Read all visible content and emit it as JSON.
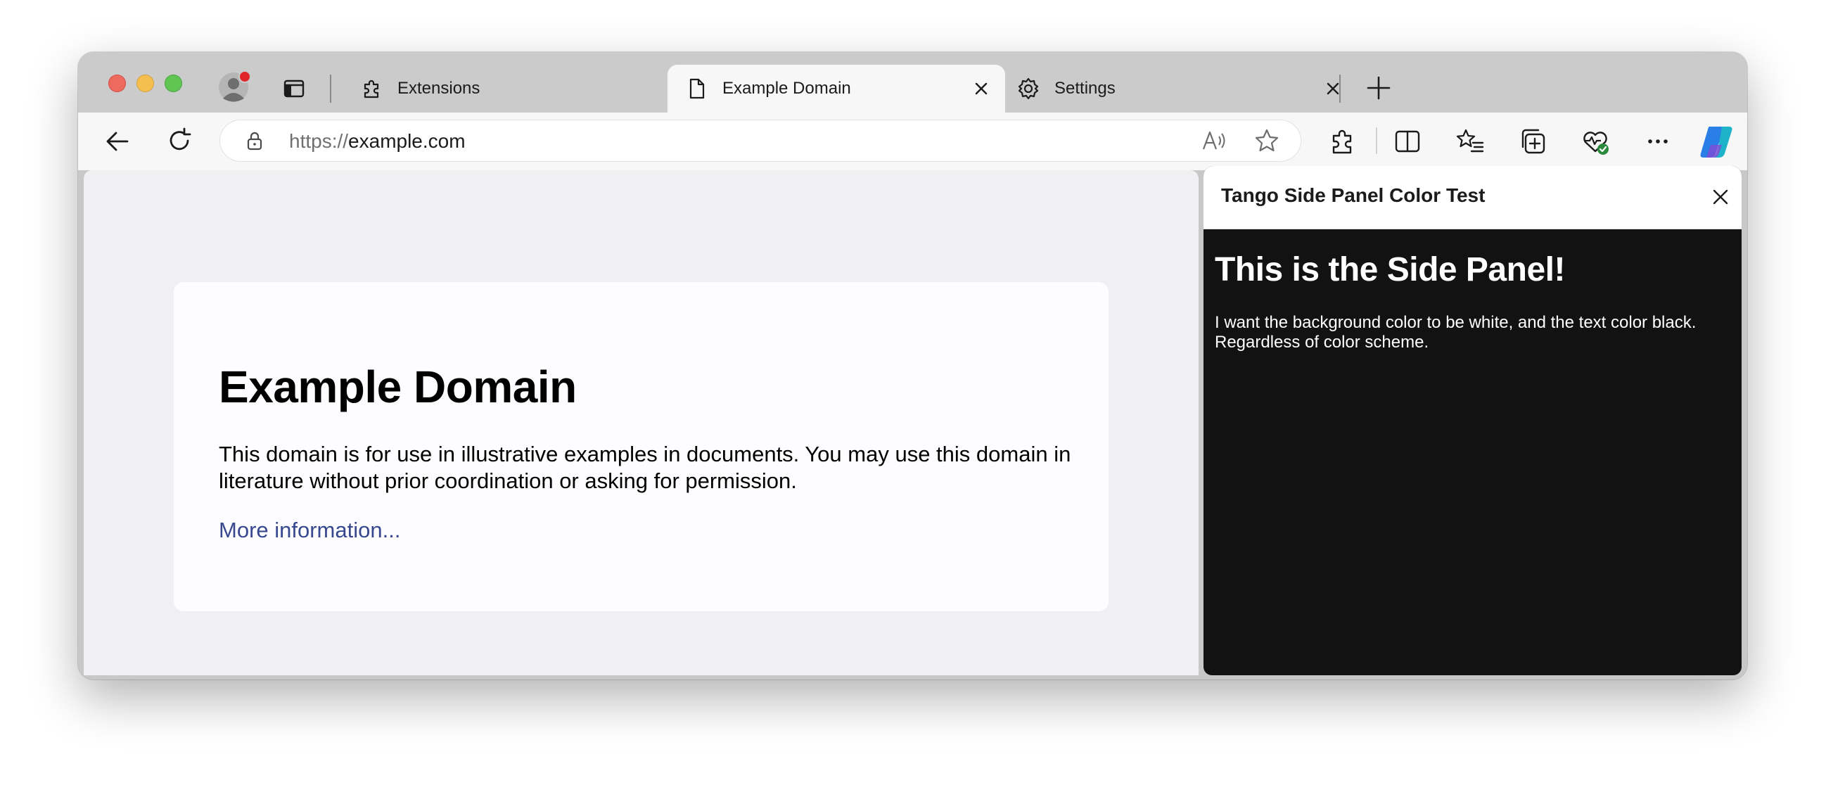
{
  "tabs": [
    {
      "label": "Extensions",
      "icon": "puzzle-icon",
      "active": false
    },
    {
      "label": "Example Domain",
      "icon": "document-icon",
      "active": true
    },
    {
      "label": "Settings",
      "icon": "gear-icon",
      "active": false
    }
  ],
  "address_bar": {
    "scheme": "https://",
    "host": "example.com"
  },
  "page": {
    "heading": "Example Domain",
    "body": "This domain is for use in illustrative examples in documents. You may use this domain in literature without prior coordination or asking for permission.",
    "link": "More information..."
  },
  "side_panel": {
    "title": "Tango Side Panel Color Test",
    "heading": "This is the Side Panel!",
    "body": "I want the background color to be white, and the text color black. Regardless of color scheme."
  },
  "colors": {
    "page_background": "#f0f0f2",
    "card_background": "#fdfdff",
    "link": "#38488f",
    "side_panel_background": "#121212",
    "notification_dot": "#e0262a",
    "copilot_accent": "#2a7fe6"
  }
}
